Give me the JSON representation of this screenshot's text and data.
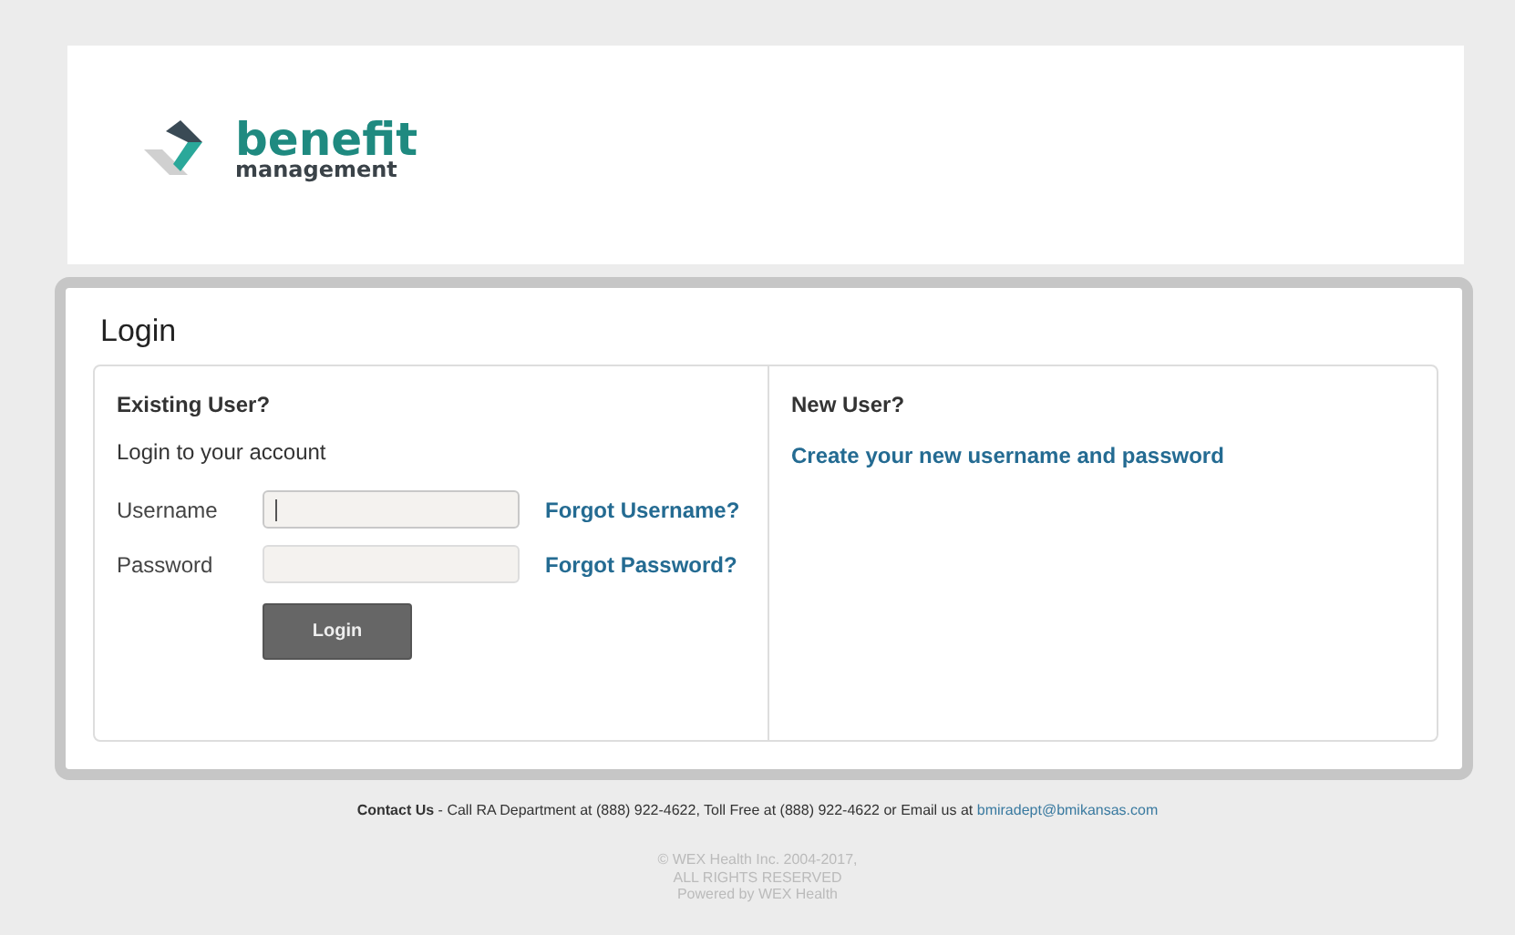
{
  "logo": {
    "title": "benefit",
    "subtitle": "management"
  },
  "login": {
    "title": "Login",
    "existing": {
      "heading": "Existing User?",
      "intro": "Login to your account",
      "fields": [
        {
          "label": "Username",
          "focused": true,
          "link": "Forgot Username?"
        },
        {
          "label": "Password",
          "focused": false,
          "link": "Forgot Password?"
        }
      ],
      "button": "Login"
    },
    "new_user": {
      "heading": "New User?",
      "link": "Create your new username and password"
    }
  },
  "footer": {
    "contact": "**Contact Us** - Call RA Department at (888) 922-4622, Toll Free at (888) 922-4622 or Email us at",
    "email": "bmiradept@bmikansas.com",
    "copyright": [
      "© WEX Health Inc. 2004-2017,",
      "ALL RIGHTS RESERVED",
      "Powered by WEX Health"
    ]
  }
}
